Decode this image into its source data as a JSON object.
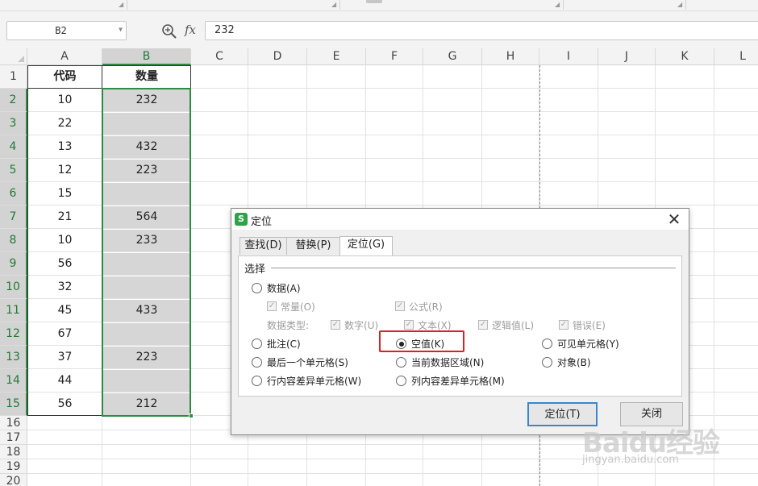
{
  "formula_bar": {
    "name_box": "B2",
    "fx_label": "fx",
    "formula_value": "232"
  },
  "sheet": {
    "columns": [
      "A",
      "B",
      "C",
      "D",
      "E",
      "F",
      "G",
      "H",
      "I",
      "J",
      "K",
      "L"
    ],
    "selected_column": "B",
    "rows": [
      "1",
      "2",
      "3",
      "4",
      "5",
      "6",
      "7",
      "8",
      "9",
      "10",
      "11",
      "12",
      "13",
      "14",
      "15",
      "16",
      "17",
      "18",
      "19",
      "20"
    ],
    "selected_rows": [
      "2",
      "3",
      "4",
      "5",
      "6",
      "7",
      "8",
      "9",
      "10",
      "11",
      "12",
      "13",
      "14",
      "15"
    ],
    "header": [
      "代码",
      "数量"
    ],
    "data": [
      [
        "10",
        "232"
      ],
      [
        "22",
        ""
      ],
      [
        "13",
        "432"
      ],
      [
        "12",
        "223"
      ],
      [
        "15",
        ""
      ],
      [
        "21",
        "564"
      ],
      [
        "10",
        "233"
      ],
      [
        "56",
        ""
      ],
      [
        "32",
        ""
      ],
      [
        "45",
        "433"
      ],
      [
        "67",
        ""
      ],
      [
        "37",
        "223"
      ],
      [
        "44",
        ""
      ],
      [
        "56",
        "212"
      ]
    ]
  },
  "dialog": {
    "title": "定位",
    "tabs": [
      {
        "label": "查找(D)",
        "active": false
      },
      {
        "label": "替换(P)",
        "active": false
      },
      {
        "label": "定位(G)",
        "active": true
      }
    ],
    "group_label": "选择",
    "options": {
      "data": "数据(A)",
      "constant": "常量(O)",
      "formula": "公式(R)",
      "data_types_label": "数据类型:",
      "number": "数字(U)",
      "text": "文本(X)",
      "logical": "逻辑值(L)",
      "error": "错误(E)",
      "comment": "批注(C)",
      "blank": "空值(K)",
      "visible_cells": "可见单元格(Y)",
      "last_cell": "最后一个单元格(S)",
      "current_region": "当前数据区域(N)",
      "objects": "对象(B)",
      "row_diff": "行内容差异单元格(W)",
      "col_diff": "列内容差异单元格(M)"
    },
    "selected_option": "空值(K)",
    "buttons": {
      "locate": "定位(T)",
      "close": "关闭"
    }
  },
  "watermark": {
    "brand": "Baidu经验",
    "url": "jingyan.baidu.com"
  },
  "colors": {
    "selection_green": "#2e8b43",
    "highlight_red": "#e02020",
    "logo_green": "#2fa14a",
    "button_focus_blue": "#3a87c9"
  }
}
